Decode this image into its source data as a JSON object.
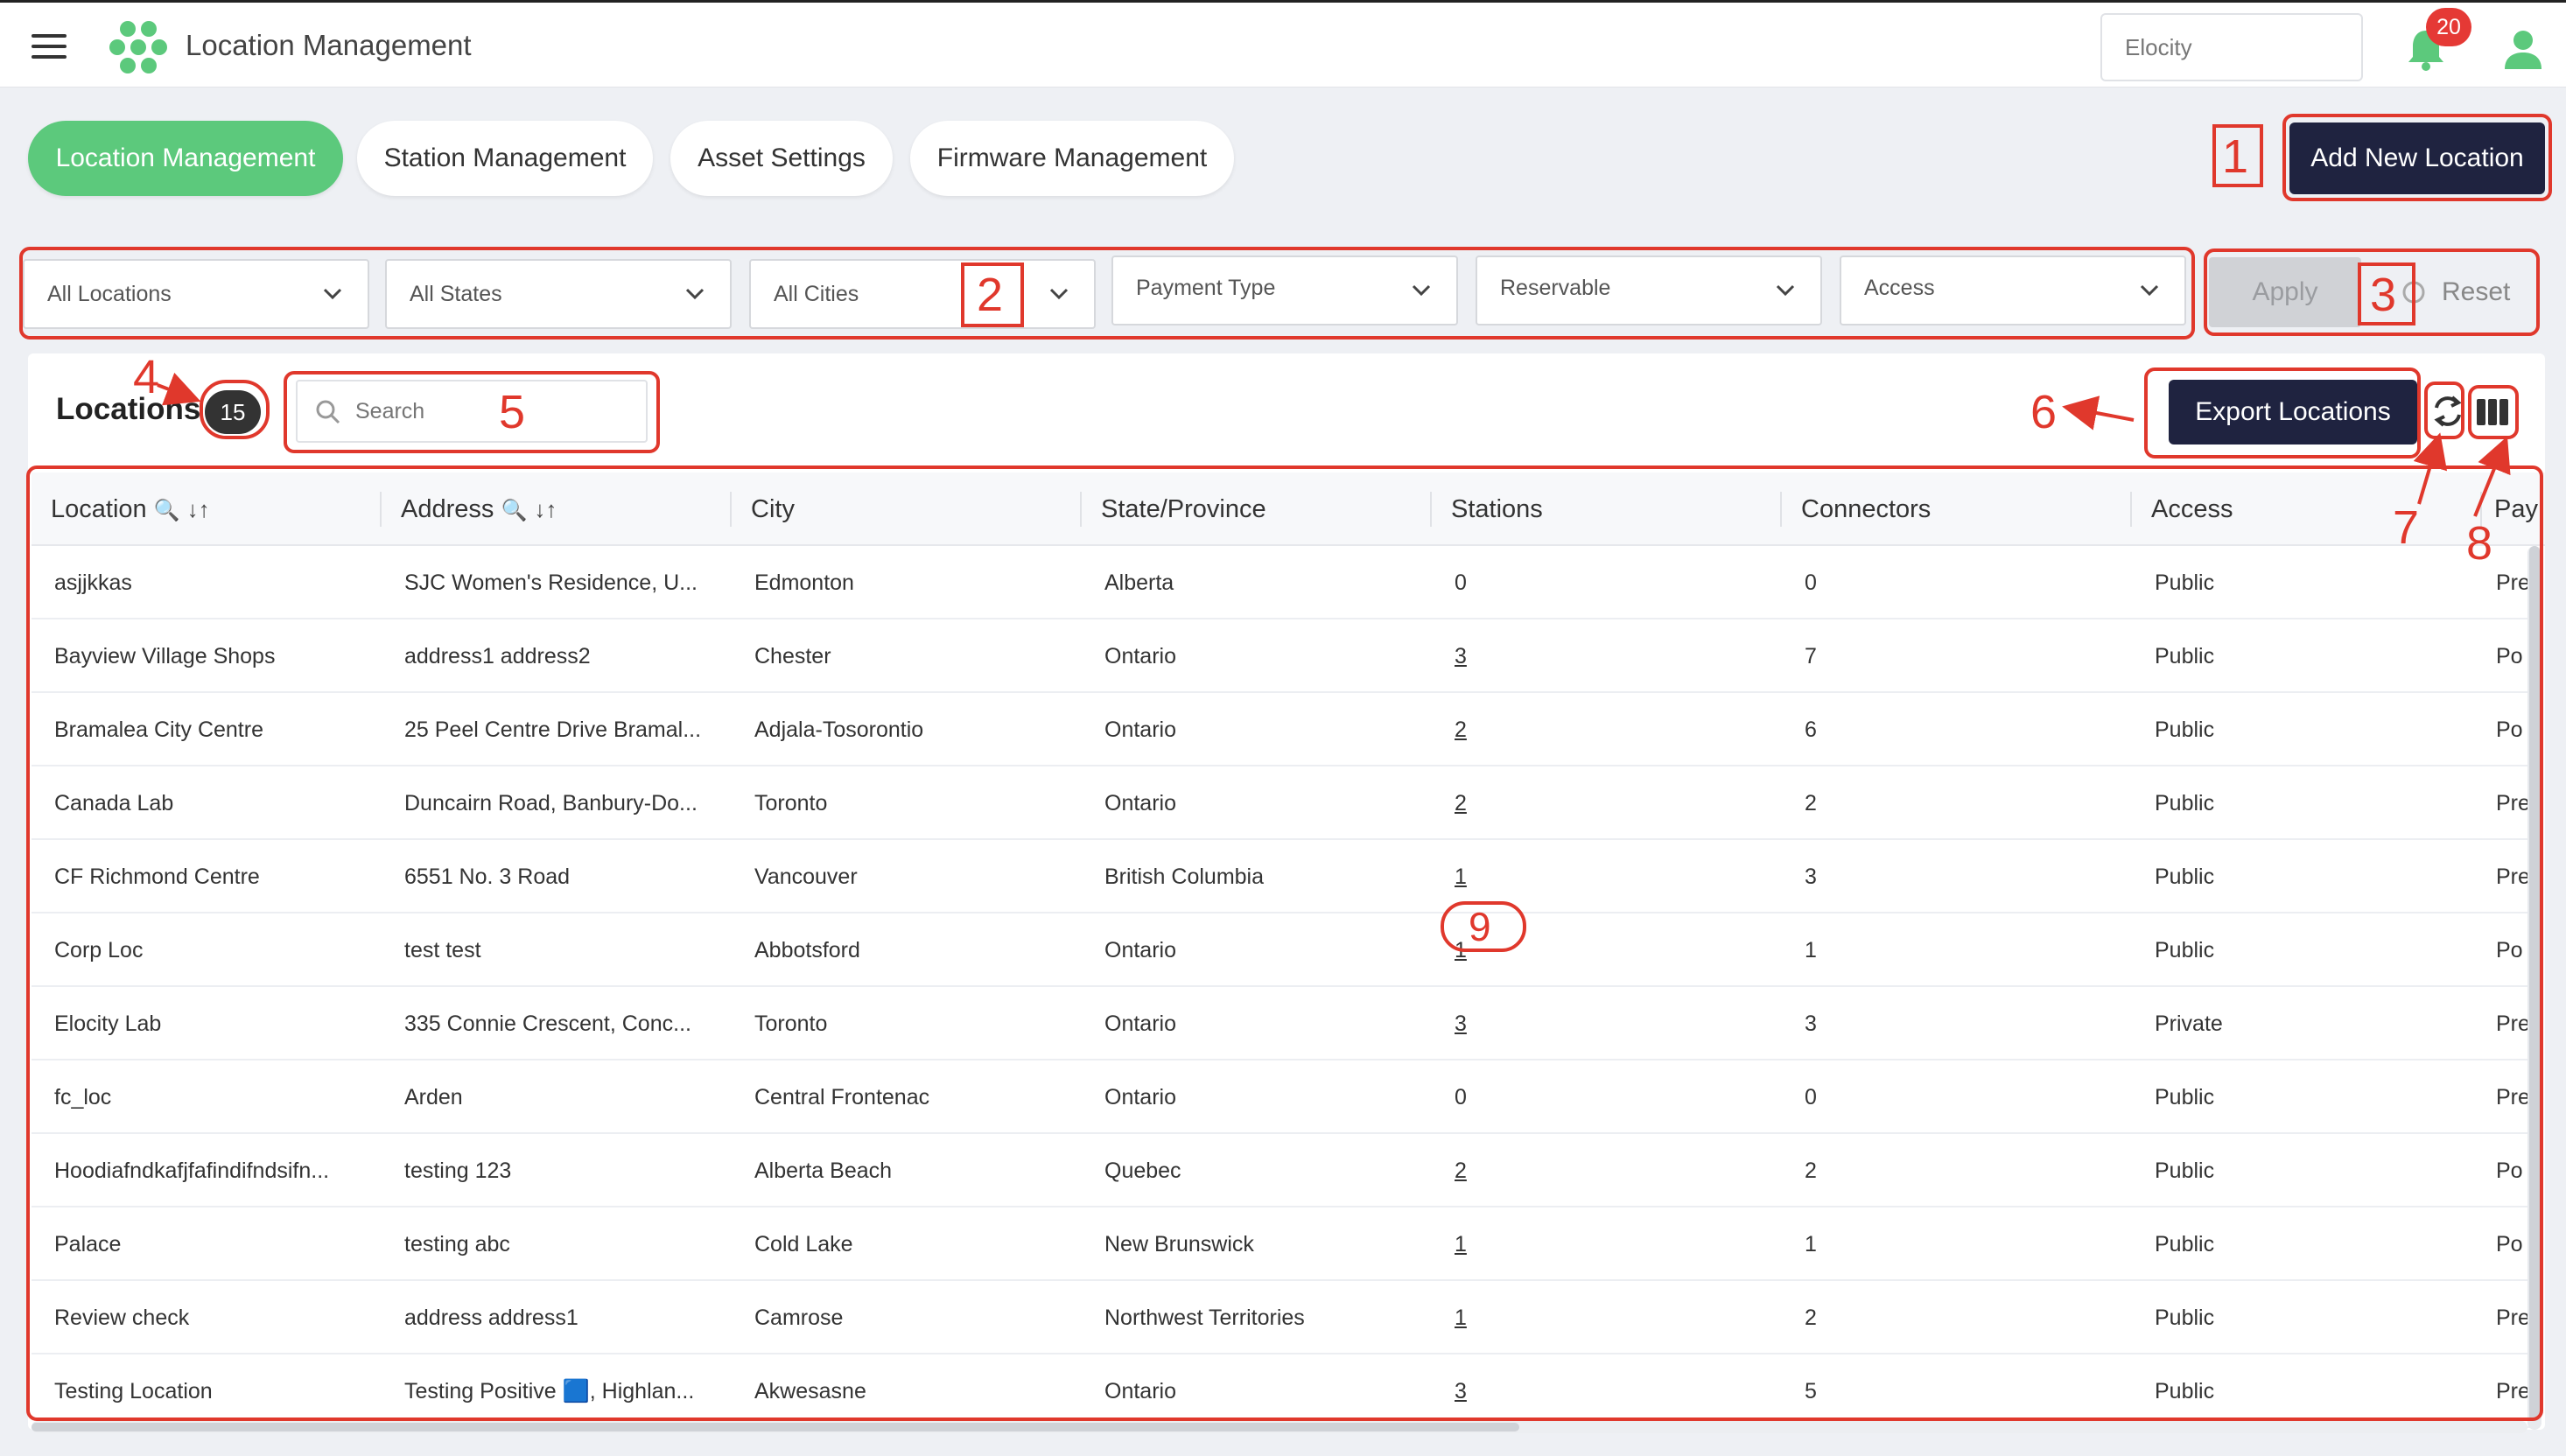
{
  "app": {
    "title": "Location Management",
    "org": "Elocity",
    "notifications": "20"
  },
  "tabs": [
    "Location Management",
    "Station Management",
    "Asset Settings",
    "Firmware Management"
  ],
  "add_button": "Add New Location",
  "filters": [
    "All Locations",
    "All States",
    "All Cities",
    "Payment Type",
    "Reservable",
    "Access"
  ],
  "apply_label": "Apply",
  "reset_label": "Reset",
  "panel": {
    "title": "Locations",
    "count": "15",
    "search_placeholder": "Search",
    "export_label": "Export Locations"
  },
  "columns": [
    "Location",
    "Address",
    "City",
    "State/Province",
    "Stations",
    "Connectors",
    "Access",
    "Pay"
  ],
  "rows": [
    [
      "asjjkkas",
      "SJC Women's Residence, U...",
      "Edmonton",
      "Alberta",
      "0",
      "0",
      "Public",
      "Pre"
    ],
    [
      "Bayview Village Shops",
      "address1 address2",
      "Chester",
      "Ontario",
      "3",
      "7",
      "Public",
      "Po"
    ],
    [
      "Bramalea City Centre",
      "25 Peel Centre Drive Bramal...",
      "Adjala-Tosorontio",
      "Ontario",
      "2",
      "6",
      "Public",
      "Po"
    ],
    [
      "Canada Lab",
      "Duncairn Road, Banbury-Do...",
      "Toronto",
      "Ontario",
      "2",
      "2",
      "Public",
      "Pre"
    ],
    [
      "CF Richmond Centre",
      "6551 No. 3 Road",
      "Vancouver",
      "British Columbia",
      "1",
      "3",
      "Public",
      "Pre"
    ],
    [
      "Corp Loc",
      "test test",
      "Abbotsford",
      "Ontario",
      "1",
      "1",
      "Public",
      "Po"
    ],
    [
      "Elocity Lab",
      "335 Connie Crescent, Conc...",
      "Toronto",
      "Ontario",
      "3",
      "3",
      "Private",
      "Pre"
    ],
    [
      "fc_loc",
      "Arden",
      "Central Frontenac",
      "Ontario",
      "0",
      "0",
      "Public",
      "Pre"
    ],
    [
      "Hoodiafndkafjfafindifndsifn...",
      "testing 123",
      "Alberta Beach",
      "Quebec",
      "2",
      "2",
      "Public",
      "Po"
    ],
    [
      "Palace",
      "testing abc",
      "Cold Lake",
      "New Brunswick",
      "1",
      "1",
      "Public",
      "Po"
    ],
    [
      "Review check",
      "address address1",
      "Camrose",
      "Northwest Territories",
      "1",
      "2",
      "Public",
      "Pre"
    ],
    [
      "Testing Location",
      "Testing Positive 🟦, Highlan...",
      "Akwesasne",
      "Ontario",
      "3",
      "5",
      "Public",
      "Pre"
    ]
  ],
  "annotations": [
    "1",
    "2",
    "3",
    "4",
    "5",
    "6",
    "7",
    "8",
    "9"
  ],
  "colors": {
    "accent_green": "#5cc97c",
    "navy_button": "#1f2340",
    "annotation_red": "#e0382c",
    "badge_red": "#e53935"
  }
}
